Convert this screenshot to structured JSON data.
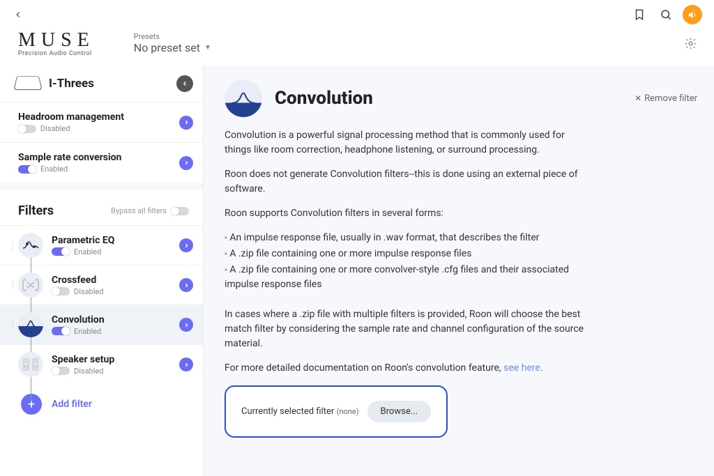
{
  "logo": {
    "title": "MUSE",
    "subtitle": "Precision Audio Control"
  },
  "presets": {
    "label": "Presets",
    "value": "No preset set"
  },
  "device": {
    "name": "I-Threes"
  },
  "settings": [
    {
      "title": "Headroom management",
      "state": "Disabled",
      "enabled": false
    },
    {
      "title": "Sample rate conversion",
      "state": "Enabled",
      "enabled": true
    }
  ],
  "filters_section": {
    "title": "Filters",
    "bypass_label": "Bypass all filters"
  },
  "filters": [
    {
      "name": "Parametric EQ",
      "state": "Enabled",
      "enabled": true
    },
    {
      "name": "Crossfeed",
      "state": "Disabled",
      "enabled": false
    },
    {
      "name": "Convolution",
      "state": "Enabled",
      "enabled": true,
      "selected": true
    },
    {
      "name": "Speaker setup",
      "state": "Disabled",
      "enabled": false
    }
  ],
  "add_filter_label": "Add filter",
  "content": {
    "title": "Convolution",
    "remove_label": "Remove filter",
    "p1": "Convolution is a powerful signal processing method that is commonly used for things like room correction, headphone listening, or surround processing.",
    "p2": "Roon does not generate Convolution filters--this is done using an external piece of software.",
    "p3": "Roon supports Convolution filters in several forms:",
    "b1": "- An impulse response file, usually in .wav format, that describes the filter",
    "b2": "- A .zip file containing one or more impulse response files",
    "b3": "- A .zip file containing one or more convolver-style .cfg files and their associated impulse response files",
    "p4": "In cases where a .zip file with multiple filters is provided, Roon will choose the best match filter by considering the sample rate and channel configuration of the source material.",
    "p5a": "For more detailed documentation on Roon's convolution feature, ",
    "p5b": "see here",
    "p5c": ".",
    "selected_label": "Currently selected filter",
    "selected_value": "(none)",
    "browse_label": "Browse..."
  }
}
